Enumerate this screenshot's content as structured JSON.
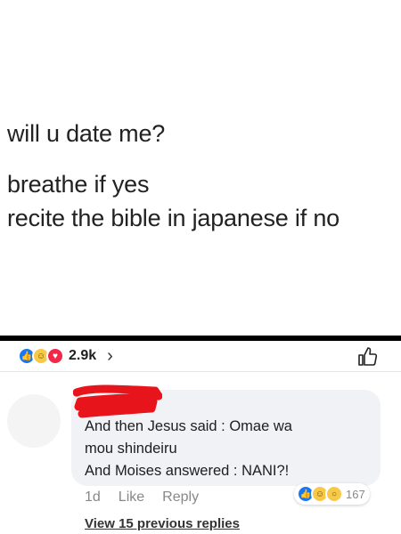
{
  "post": {
    "lines": [
      "will u date me?",
      "breathe if yes",
      "recite the bible in japanese if no"
    ]
  },
  "reactions_bar": {
    "icons": [
      "like-icon",
      "haha-icon",
      "love-icon"
    ],
    "count": "2.9k",
    "chevron": "›"
  },
  "comment": {
    "line1": "And then Jesus said : Omae wa",
    "line2": "mou shindeiru",
    "line3": "And Moises answered : NANI?!",
    "time": "1d",
    "like_label": "Like",
    "reply_label": "Reply",
    "reaction_icons": [
      "like-icon",
      "haha-icon",
      "wow-icon"
    ],
    "reaction_count": "167",
    "view_replies": "View 15 previous replies"
  },
  "colors": {
    "like": "#1877f2",
    "love": "#f0284a",
    "haha": "#f7c948",
    "redaction": "#e8141c"
  }
}
